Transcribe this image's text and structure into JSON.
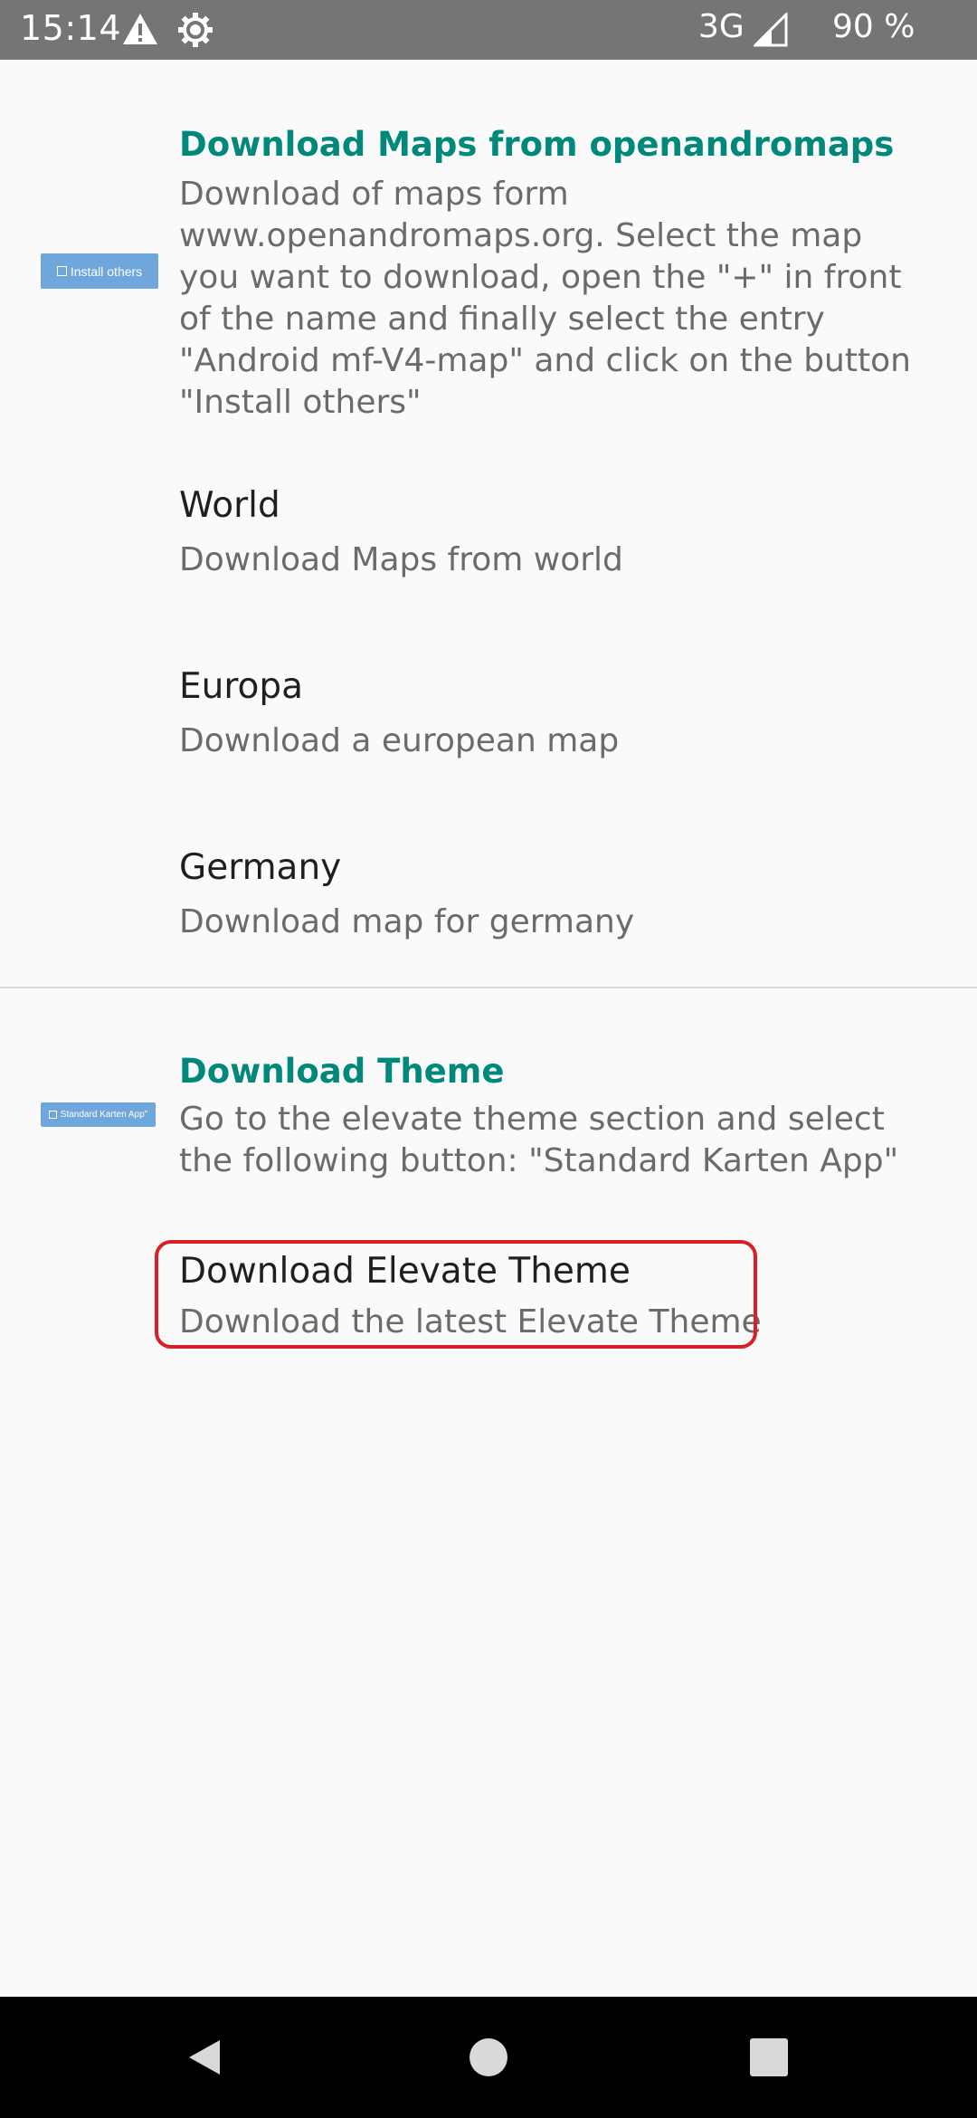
{
  "status_bar": {
    "time": "15:14",
    "network": "3G",
    "battery": "90 %",
    "icons": [
      "warning-icon",
      "gear-icon",
      "signal-icon"
    ]
  },
  "maps_section": {
    "header": {
      "title": "Download Maps from openandromaps",
      "summary": "Download of maps form www.openandromaps.org. Select the map you want to download, open the \"+\" in front of the name and finally select the entry \"Android mf-V4-map\" and click on the button \"Install others\"",
      "thumbnail_label": "Install others"
    },
    "items": [
      {
        "title": "World",
        "summary": "Download Maps from world"
      },
      {
        "title": "Europa",
        "summary": "Download a european map"
      },
      {
        "title": "Germany",
        "summary": "Download map for germany"
      }
    ]
  },
  "theme_section": {
    "header": {
      "title": "Download Theme",
      "summary": "Go to the elevate theme section and select the following button: \"Standard Karten App\"",
      "thumbnail_label": "Standard Karten App\""
    },
    "items": [
      {
        "title": "Download Elevate Theme",
        "summary": "Download the latest Elevate Theme"
      }
    ]
  },
  "colors": {
    "accent": "#00897b",
    "status_bar": "#757575",
    "highlight": "#d9202a",
    "thumbnail": "#6fa6dc"
  },
  "nav_bar": {
    "icons": [
      "back-icon",
      "home-icon",
      "recents-icon"
    ]
  }
}
